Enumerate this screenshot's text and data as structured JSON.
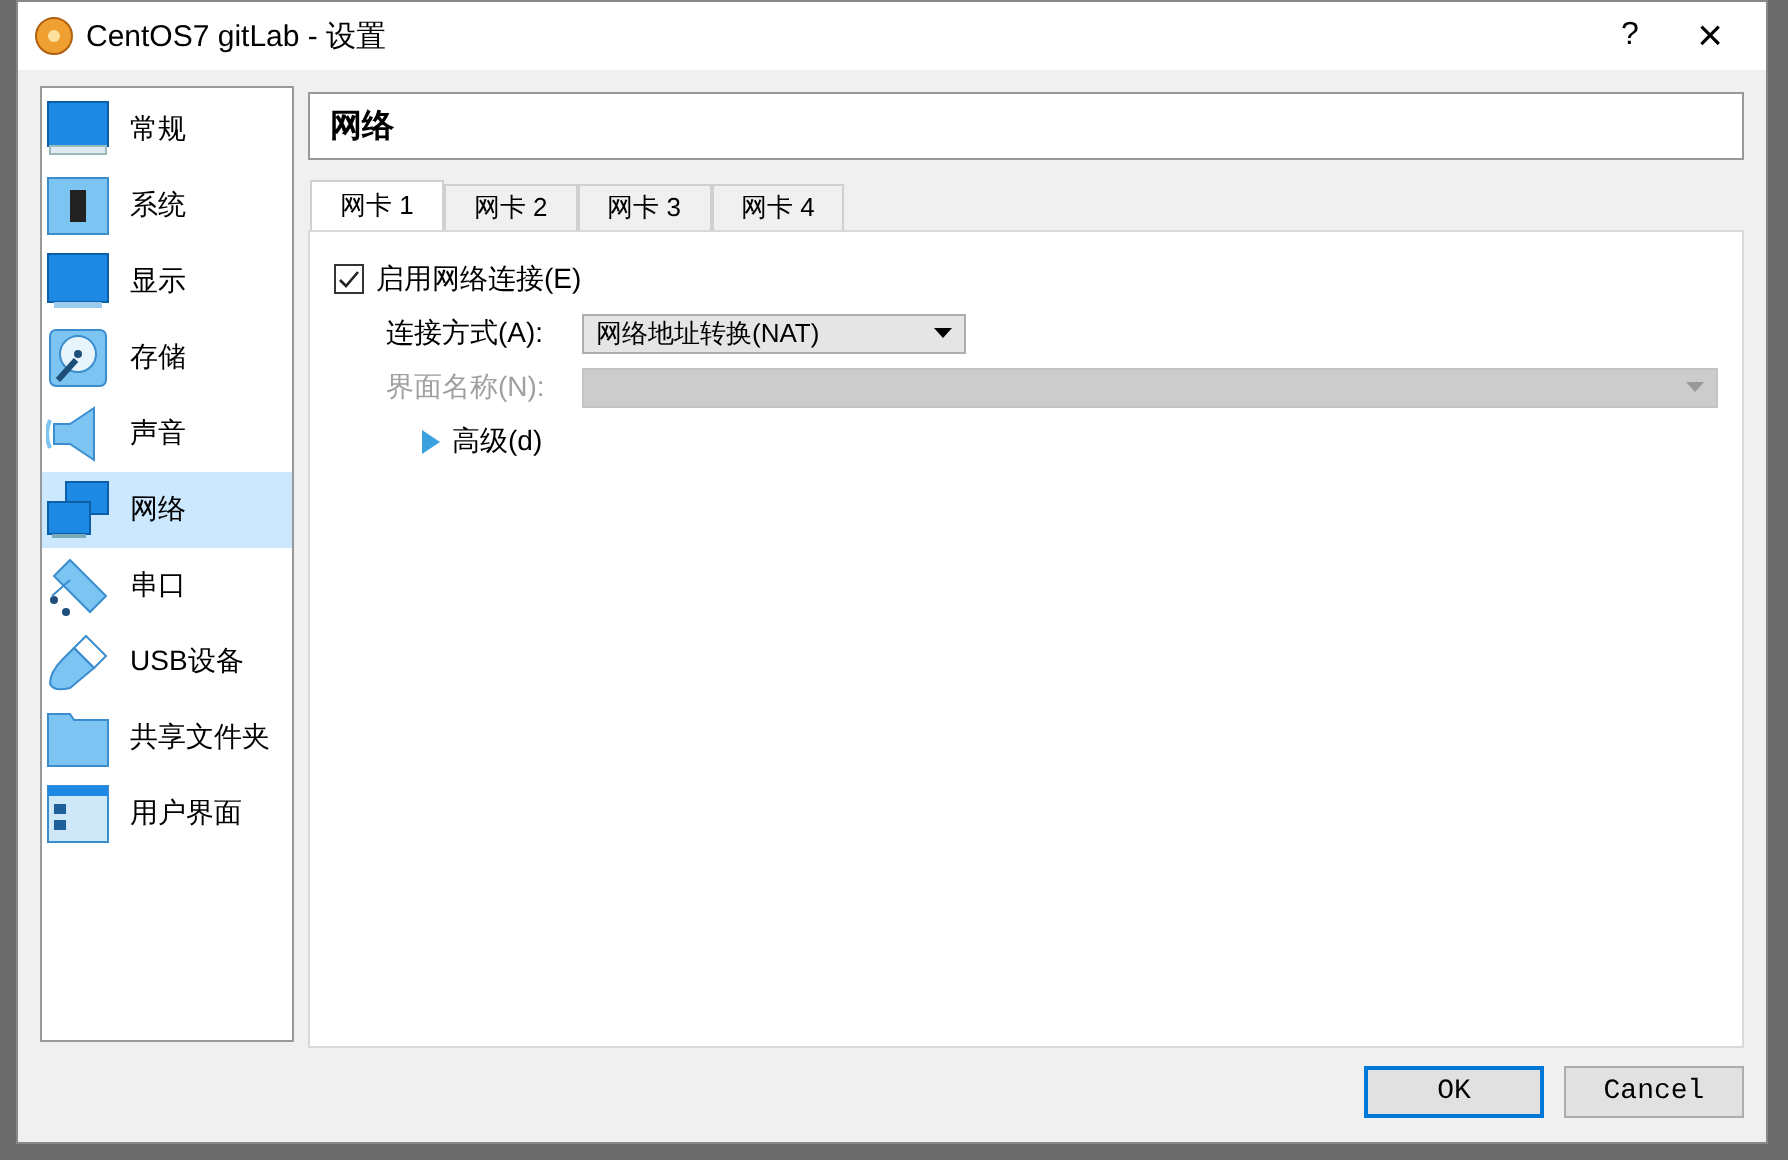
{
  "window": {
    "title": "CentOS7 gitLab - 设置",
    "help": "?",
    "close": "×"
  },
  "sidebar": {
    "items": [
      {
        "label": "常规",
        "kind": "monitor",
        "selected": false
      },
      {
        "label": "系统",
        "kind": "chip",
        "selected": false
      },
      {
        "label": "显示",
        "kind": "display",
        "selected": false
      },
      {
        "label": "存储",
        "kind": "disk",
        "selected": false
      },
      {
        "label": "声音",
        "kind": "speaker",
        "selected": false
      },
      {
        "label": "网络",
        "kind": "network",
        "selected": true
      },
      {
        "label": "串口",
        "kind": "serial",
        "selected": false
      },
      {
        "label": "USB设备",
        "kind": "usb",
        "selected": false
      },
      {
        "label": "共享文件夹",
        "kind": "folder",
        "selected": false
      },
      {
        "label": "用户界面",
        "kind": "ui",
        "selected": false
      }
    ]
  },
  "page_title": "网络",
  "tabs": [
    {
      "label": "网卡 1",
      "selected": true
    },
    {
      "label": "网卡 2",
      "selected": false
    },
    {
      "label": "网卡 3",
      "selected": false
    },
    {
      "label": "网卡 4",
      "selected": false
    }
  ],
  "enable": {
    "label": "启用网络连接(E)",
    "checked": true
  },
  "fields": [
    {
      "label": "连接方式(A):",
      "value": "网络地址转换(NAT)",
      "disabled": false
    },
    {
      "label": "界面名称(N):",
      "disabled": true
    }
  ],
  "advanced": {
    "label": "高级(d)",
    "expanded": false
  },
  "buttons": [
    {
      "label": "OK",
      "default": true
    },
    {
      "label": "Cancel",
      "default": false
    }
  ]
}
